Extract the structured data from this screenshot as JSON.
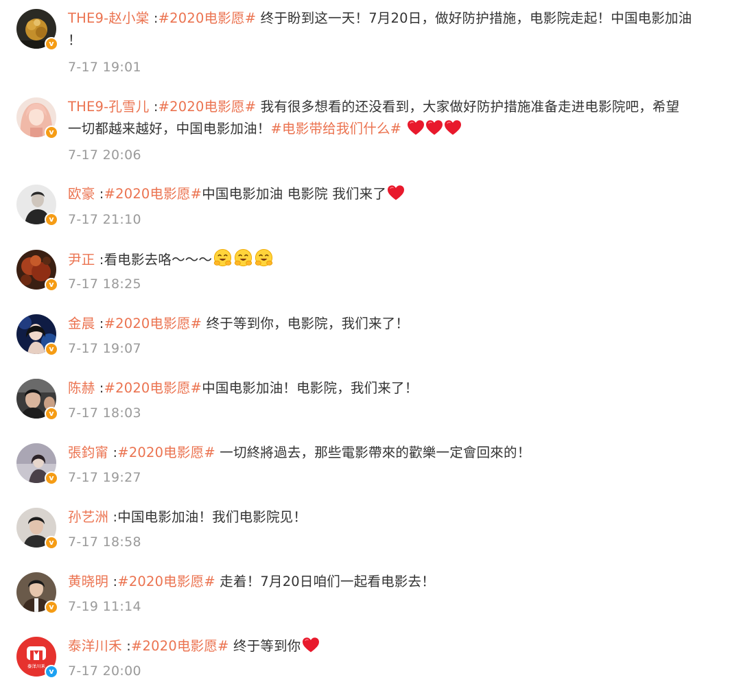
{
  "separator": " :",
  "comments": [
    {
      "user": "THE9-赵小棠",
      "badge": "v",
      "topic": "#2020电影愿#",
      "line1": " 终于盼到这一天！7月20日，做好防护措施，电影院走起！中国电影加油",
      "line2": "！",
      "time": "7-17 19:01"
    },
    {
      "user": "THE9-孔雪儿",
      "badge": "v",
      "topic": "#2020电影愿#",
      "line1": " 我有很多想看的还没看到，大家做好防护措施准备走进电影院吧，希望",
      "line2_text": "一切都越来越好，中国电影加油！",
      "line2_topic": "#电影带给我们什么#",
      "icons": [
        "heart-icon",
        "heart-icon",
        "heart-icon"
      ],
      "time": "7-17 20:06"
    },
    {
      "user": "欧豪",
      "badge": "v",
      "topic": "#2020电影愿#",
      "text": "中国电影加油 电影院 我们来了",
      "icons": [
        "heart-icon"
      ],
      "time": "7-17 21:10"
    },
    {
      "user": "尹正",
      "badge": "v",
      "text": "看电影去咯～～～",
      "icons": [
        "hugging-face-icon",
        "hugging-face-icon",
        "hugging-face-icon"
      ],
      "time": "7-17 18:25"
    },
    {
      "user": "金晨",
      "badge": "v",
      "topic": "#2020电影愿#",
      "text": " 终于等到你，电影院，我们来了！",
      "time": "7-17 19:07"
    },
    {
      "user": "陈赫",
      "badge": "v",
      "topic": "#2020电影愿#",
      "text": "中国电影加油！电影院，我们来了！",
      "time": "7-17 18:03"
    },
    {
      "user": "張鈞甯",
      "badge": "v",
      "topic": "#2020电影愿#",
      "text": " 一切終將過去，那些電影帶來的歡樂一定會回來的！",
      "time": "7-17 19:27"
    },
    {
      "user": "孙艺洲",
      "badge": "v",
      "text": "中国电影加油！我们电影院见！",
      "time": "7-17 18:58"
    },
    {
      "user": "黄晓明",
      "badge": "v",
      "topic": "#2020电影愿#",
      "text": " 走着！7月20日咱们一起看电影去！",
      "time": "7-19 11:14"
    },
    {
      "user": "泰洋川禾",
      "badge": "v",
      "topic": "#2020电影愿#",
      "text": " 终于等到你",
      "icons": [
        "heart-icon"
      ],
      "avatar_logo_text": "泰洋川禾",
      "time": "7-17 20:00"
    }
  ],
  "colors": {
    "username": "#eb7350",
    "topic": "#eb7350",
    "text": "#333333",
    "time": "#9a9a9a",
    "badge_orange": "#f59c15",
    "badge_blue": "#1da1f2",
    "heart": "#e8192c"
  }
}
